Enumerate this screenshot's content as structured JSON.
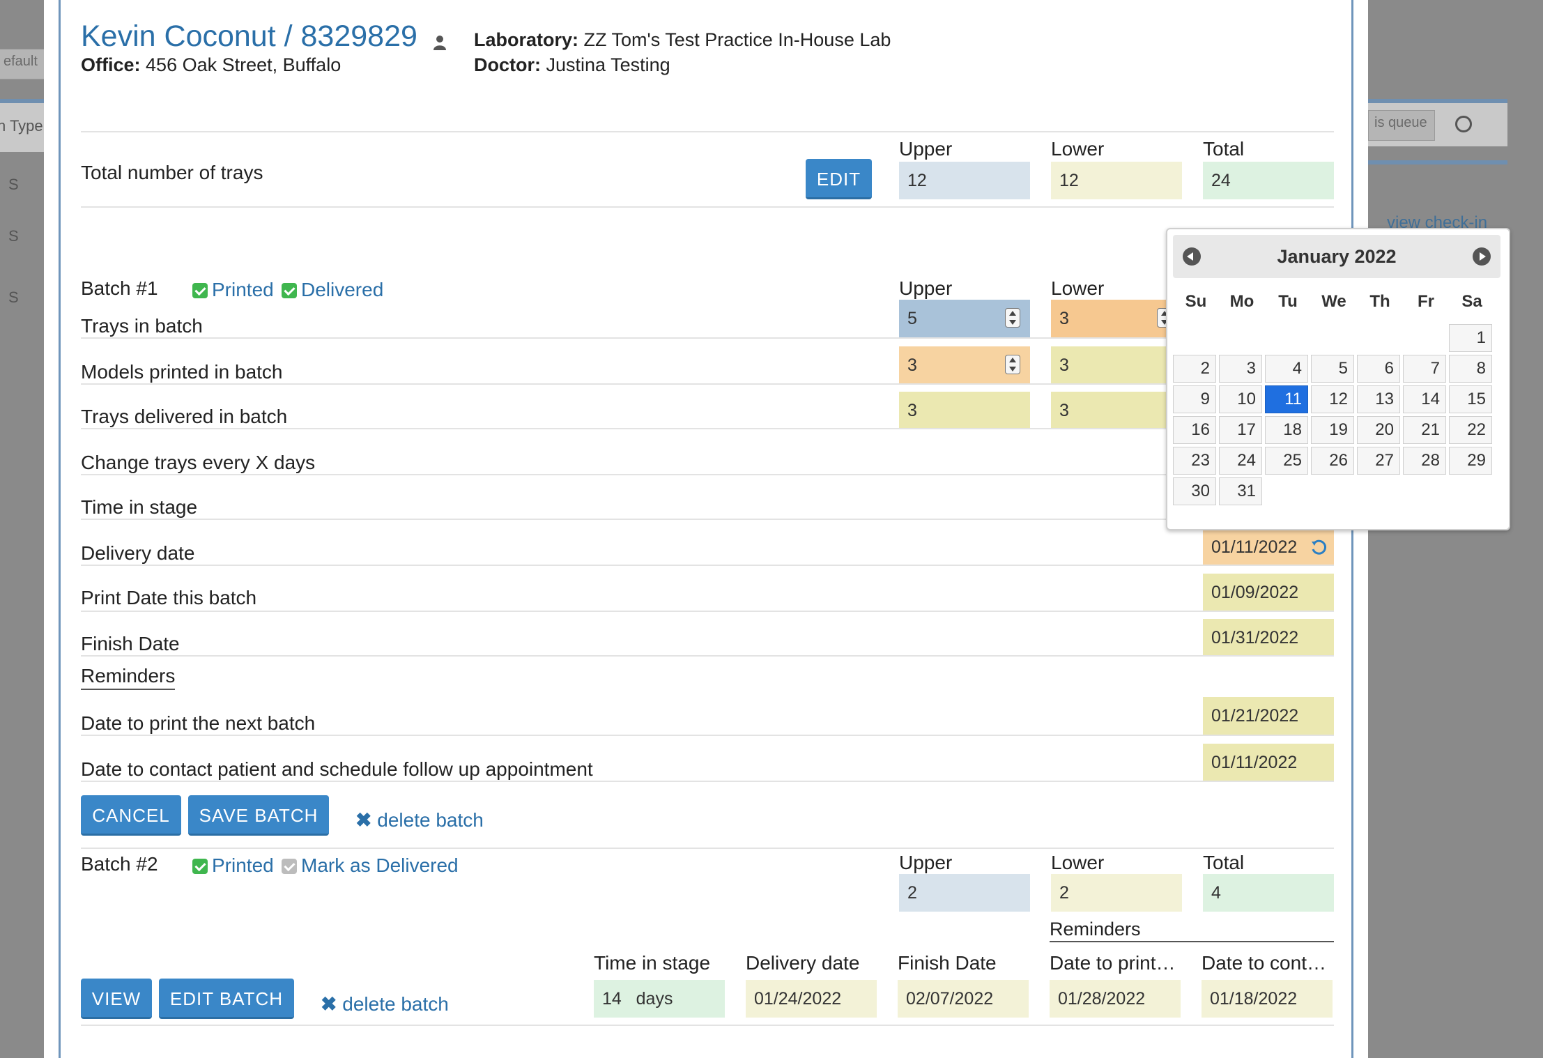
{
  "background": {
    "input_default": "efault",
    "col_type": "n Type",
    "queue_placeholder": "is queue",
    "view_checkin": "view check-in",
    "row_letter": "S"
  },
  "header": {
    "patient": "Kevin Coconut / 8329829",
    "office_label": "Office:",
    "office_value": "456 Oak Street, Buffalo",
    "lab_label": "Laboratory:",
    "lab_value": "ZZ Tom's Test Practice In-House Lab",
    "doctor_label": "Doctor:",
    "doctor_value": "Justina Testing"
  },
  "trays": {
    "label": "Total number of trays",
    "edit_button": "EDIT",
    "upper_label": "Upper",
    "lower_label": "Lower",
    "total_label": "Total",
    "upper": "12",
    "lower": "12",
    "total": "24"
  },
  "batch1": {
    "title": "Batch #1",
    "printed": "Printed",
    "delivered": "Delivered",
    "upper_label": "Upper",
    "lower_label": "Lower",
    "rows": {
      "trays_in_batch": "Trays in batch",
      "models_printed": "Models printed in batch",
      "trays_delivered": "Trays delivered in batch",
      "change_trays": "Change trays every X days",
      "time_in_stage": "Time in stage",
      "delivery_date": "Delivery date",
      "print_date": "Print Date this batch",
      "finish_date": "Finish Date"
    },
    "values": {
      "trays_upper": "5",
      "trays_lower": "3",
      "models_upper": "3",
      "models_lower": "3",
      "delivered_upper": "3",
      "delivered_lower": "3",
      "delivery_date": "01/11/2022",
      "print_date": "01/09/2022",
      "finish_date": "01/31/2022"
    },
    "reminders_label": "Reminders",
    "next_batch_label": "Date to print the next batch",
    "next_batch_value": "01/21/2022",
    "contact_label": "Date to contact patient and schedule follow up appointment",
    "contact_value": "01/11/2022",
    "cancel": "CANCEL",
    "save": "SAVE BATCH",
    "delete": "delete batch"
  },
  "batch2": {
    "title": "Batch #2",
    "printed": "Printed",
    "mark_delivered": "Mark as Delivered",
    "upper_label": "Upper",
    "lower_label": "Lower",
    "total_label": "Total",
    "upper": "2",
    "lower": "2",
    "total": "4",
    "reminders_label": "Reminders",
    "col_time": "Time in stage",
    "col_delivery": "Delivery date",
    "col_finish": "Finish Date",
    "col_print": "Date to print…",
    "col_contact": "Date to cont…",
    "time_value": "14",
    "time_unit": "days",
    "delivery": "01/24/2022",
    "finish": "02/07/2022",
    "print": "01/28/2022",
    "contact": "01/18/2022",
    "view": "VIEW",
    "edit": "EDIT BATCH",
    "delete": "delete batch"
  },
  "calendar": {
    "title": "January 2022",
    "dows": [
      "Su",
      "Mo",
      "Tu",
      "We",
      "Th",
      "Fr",
      "Sa"
    ],
    "weeks": [
      [
        "",
        "",
        "",
        "",
        "",
        "",
        "1"
      ],
      [
        "2",
        "3",
        "4",
        "5",
        "6",
        "7",
        "8"
      ],
      [
        "9",
        "10",
        "11",
        "12",
        "13",
        "14",
        "15"
      ],
      [
        "16",
        "17",
        "18",
        "19",
        "20",
        "21",
        "22"
      ],
      [
        "23",
        "24",
        "25",
        "26",
        "27",
        "28",
        "29"
      ],
      [
        "30",
        "31",
        "",
        "",
        "",
        "",
        ""
      ]
    ],
    "selected": "11"
  },
  "colors": {
    "accent": "#3a87c8",
    "selected_day": "#1f6fe0",
    "check": "#3fb64e"
  }
}
